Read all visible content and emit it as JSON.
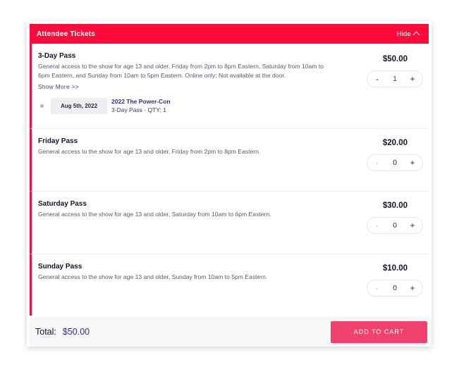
{
  "header": {
    "title": "Attendee Tickets",
    "hide_label": "Hide"
  },
  "tickets": [
    {
      "name": "3-Day Pass",
      "description": "General access to the show for age 13 and older, Friday from 2pm to 8pm Eastern, Saturday from 10am to 6pm Eastern, and Sunday from 10am to 5pm Eastern. Online only; Not available at the door.",
      "show_more": "Show More >>",
      "event": {
        "date": "Aug 5th, 2022",
        "title": "2022 The Power-Con",
        "subtitle": "3-Day Pass - QTY: 1"
      },
      "price": "$50.00",
      "qty": "1",
      "minus": "-",
      "plus": "+"
    },
    {
      "name": "Friday Pass",
      "description": "General access to the show for age 13 and older, Friday from 2pm to 8pm Eastern.",
      "price": "$20.00",
      "qty": "0",
      "minus": "-",
      "plus": "+"
    },
    {
      "name": "Saturday Pass",
      "description": "General access to the show for age 13 and older, Saturday from 10am to 6pm Eastern.",
      "price": "$30.00",
      "qty": "0",
      "minus": "-",
      "plus": "+"
    },
    {
      "name": "Sunday Pass",
      "description": "General access to the show for age 13 and older, Sunday from 10am to 5pm Eastern.",
      "price": "$10.00",
      "qty": "0",
      "minus": "-",
      "plus": "+"
    }
  ],
  "footer": {
    "total_label": "Total:",
    "total_value": "$50.00",
    "cart_button": "ADD TO CART"
  },
  "colors": {
    "header_bg": "#ff0a3a",
    "accent_border": "#e3173f",
    "cart_button": "#f1426e"
  }
}
